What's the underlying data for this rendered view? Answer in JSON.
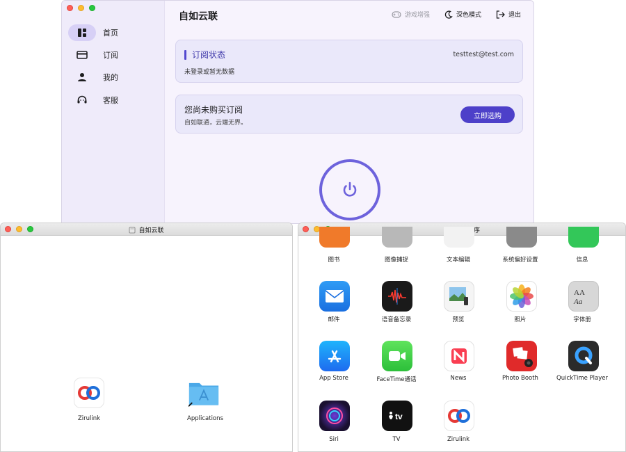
{
  "app": {
    "title": "自如云联",
    "toolbar": {
      "game_boost": "游戏增强",
      "dark_mode": "深色模式",
      "logout": "退出"
    },
    "nav": [
      {
        "label": "首页",
        "icon": "dashboard-icon",
        "active": true
      },
      {
        "label": "订阅",
        "icon": "card-icon",
        "active": false
      },
      {
        "label": "我的",
        "icon": "person-icon",
        "active": false
      },
      {
        "label": "客服",
        "icon": "headset-icon",
        "active": false
      }
    ],
    "subscription": {
      "title": "订阅状态",
      "email": "testtest@test.com",
      "status": "未登录或暂无数据"
    },
    "purchase": {
      "title": "您尚未购买订阅",
      "subtitle": "自如联通，云端无界。",
      "button": "立即选购"
    },
    "colors": {
      "accent": "#4d40c9",
      "power_ring": "#6d62dc",
      "sidebar": "#efebfa"
    }
  },
  "dmg_window": {
    "title": "自如云联",
    "items": [
      {
        "label": "Zirulink",
        "icon": "zirulink-icon"
      },
      {
        "label": "Applications",
        "icon": "applications-folder-icon"
      }
    ]
  },
  "apps_window": {
    "title": "应用程序",
    "rows": [
      [
        "图书",
        "图像捕捉",
        "文本编辑",
        "系统偏好设置",
        "信息"
      ],
      [
        "邮件",
        "语音备忘录",
        "预览",
        "照片",
        "字体册"
      ],
      [
        "App Store",
        "FaceTime通话",
        "News",
        "Photo Booth",
        "QuickTime Player"
      ],
      [
        "Siri",
        "TV",
        "Zirulink"
      ]
    ]
  }
}
